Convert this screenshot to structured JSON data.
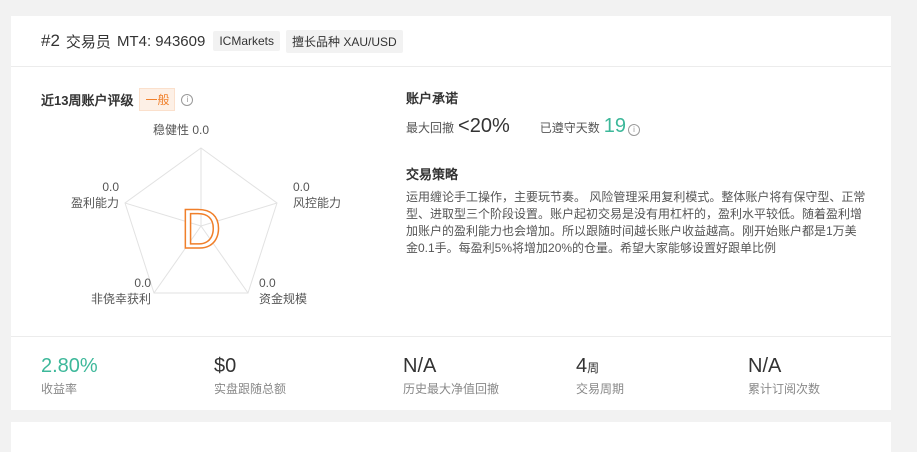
{
  "header": {
    "rank": "#2",
    "trader": "交易员",
    "mt4": "MT4: 943609",
    "broker_tag": "ICMarkets",
    "product_tag": "擅长品种 XAU/USD"
  },
  "rating": {
    "title": "近13周账户评级",
    "badge": "一般",
    "info": "i",
    "grade": "D",
    "axes": [
      {
        "name": "稳健性",
        "value": "0.0"
      },
      {
        "name": "风控能力",
        "value": "0.0"
      },
      {
        "name": "资金规模",
        "value": "0.0"
      },
      {
        "name": "非侥幸获利",
        "value": "0.0"
      },
      {
        "name": "盈利能力",
        "value": "0.0"
      }
    ]
  },
  "commitment": {
    "title": "账户承诺",
    "max_dd_label": "最大回撤",
    "max_dd_value": "<20%",
    "days_label": "已遵守天数",
    "days_value": "19",
    "info": "i"
  },
  "strategy": {
    "title": "交易策略",
    "text": "运用缠论手工操作，主要玩节奏。 风险管理采用复利模式。整体账户将有保守型、正常型、进取型三个阶段设置。账户起初交易是没有用杠杆的，盈利水平较低。随着盈利增加账户的盈利能力也会增加。所以跟随时间越长账户收益越高。刚开始账户都是1万美金0.1手。每盈利5%将增加20%的仓量。希望大家能够设置好跟单比例"
  },
  "stats": [
    {
      "value": "2.80%",
      "unit": "",
      "label": "收益率"
    },
    {
      "value": "$0",
      "unit": "",
      "label": "实盘跟随总额"
    },
    {
      "value": "N/A",
      "unit": "",
      "label": "历史最大净值回撤"
    },
    {
      "value": "4",
      "unit": "周",
      "label": "交易周期"
    },
    {
      "value": "N/A",
      "unit": "",
      "label": "累计订阅次数"
    }
  ],
  "colors": {
    "accent_green": "#3db89a",
    "grade_orange": "#f07f2a"
  }
}
